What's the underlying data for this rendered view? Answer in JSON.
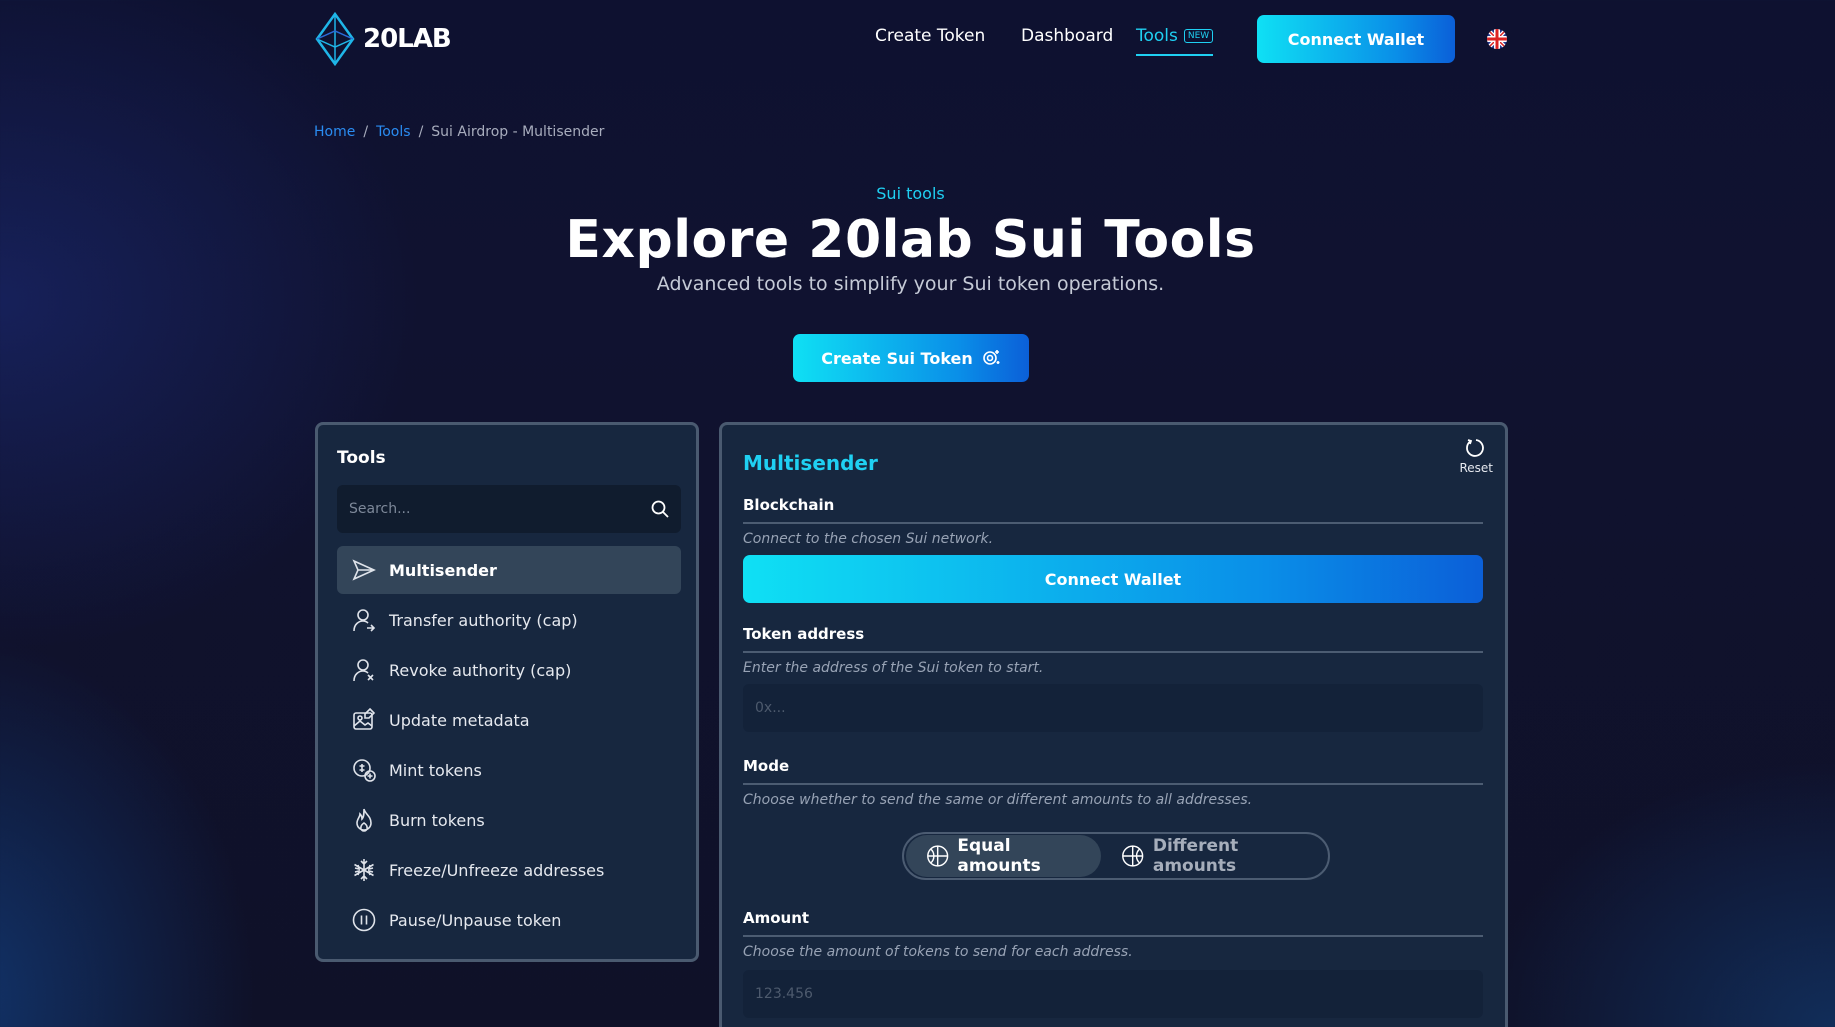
{
  "nav": {
    "logo_text": "20LAB",
    "links": [
      "Create Token",
      "Dashboard"
    ],
    "tools_label": "Tools",
    "tools_badge": "NEW",
    "connect_label": "Connect Wallet",
    "language_flag": "uk-flag-icon"
  },
  "breadcrumb": {
    "home": "Home",
    "tools": "Tools",
    "current": "Sui Airdrop - Multisender"
  },
  "hero": {
    "eyebrow": "Sui tools",
    "title": "Explore 20lab Sui Tools",
    "subtitle": "Advanced tools to simplify your Sui token operations.",
    "button_label": "Create Sui Token"
  },
  "sidebar": {
    "title": "Tools",
    "search_placeholder": "Search...",
    "items": [
      {
        "label": "Multisender",
        "icon": "send-icon",
        "active": true
      },
      {
        "label": "Transfer authority (cap)",
        "icon": "user-transfer-icon",
        "active": false
      },
      {
        "label": "Revoke authority (cap)",
        "icon": "user-revoke-icon",
        "active": false
      },
      {
        "label": "Update metadata",
        "icon": "image-edit-icon",
        "active": false
      },
      {
        "label": "Mint tokens",
        "icon": "coin-plus-icon",
        "active": false
      },
      {
        "label": "Burn tokens",
        "icon": "flame-icon",
        "active": false
      },
      {
        "label": "Freeze/Unfreeze addresses",
        "icon": "snowflake-icon",
        "active": false
      },
      {
        "label": "Pause/Unpause token",
        "icon": "pause-circle-icon",
        "active": false
      }
    ]
  },
  "multisender": {
    "title": "Multisender",
    "reset_label": "Reset",
    "blockchain": {
      "label": "Blockchain",
      "help": "Connect to the chosen Sui network.",
      "button_label": "Connect Wallet"
    },
    "token_address": {
      "label": "Token address",
      "help": "Enter the address of the Sui token to start.",
      "placeholder": "0x..."
    },
    "mode": {
      "label": "Mode",
      "help": "Choose whether to send the same or different amounts to all addresses.",
      "options": [
        "Equal amounts",
        "Different amounts"
      ],
      "selected": "Equal amounts"
    },
    "amount": {
      "label": "Amount",
      "help": "Choose the amount of tokens to send for each address.",
      "placeholder": "123.456"
    }
  },
  "colors": {
    "accent": "#1fd0f2",
    "link": "#2a8cf2",
    "panel": "#17273f"
  }
}
